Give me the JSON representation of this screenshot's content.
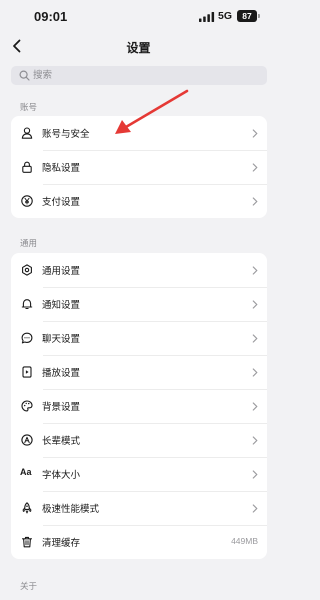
{
  "status_bar": {
    "time": "09:01",
    "network": "5G",
    "battery": "87"
  },
  "nav": {
    "title": "设置",
    "back_icon": "chevron-left-icon"
  },
  "search": {
    "placeholder": "搜索",
    "value": ""
  },
  "sections": {
    "account": {
      "header": "账号",
      "items": [
        {
          "label": "账号与安全",
          "icon": "person-icon"
        },
        {
          "label": "隐私设置",
          "icon": "lock-icon"
        },
        {
          "label": "支付设置",
          "icon": "yen-icon"
        }
      ]
    },
    "general": {
      "header": "通用",
      "items": [
        {
          "label": "通用设置",
          "icon": "gear-icon"
        },
        {
          "label": "通知设置",
          "icon": "bell-icon"
        },
        {
          "label": "聊天设置",
          "icon": "chat-bubble-icon"
        },
        {
          "label": "播放设置",
          "icon": "play-icon"
        },
        {
          "label": "背景设置",
          "icon": "palette-icon"
        },
        {
          "label": "长辈模式",
          "icon": "elder-mode-icon"
        },
        {
          "label": "字体大小",
          "icon": "font-size-icon",
          "glyph": "Aa"
        },
        {
          "label": "极速性能模式",
          "icon": "rocket-icon"
        },
        {
          "label": "清理缓存",
          "icon": "trash-icon",
          "value": "449MB"
        }
      ]
    },
    "about": {
      "header": "关于"
    }
  },
  "annotation": {
    "arrow_color": "#e53935"
  }
}
